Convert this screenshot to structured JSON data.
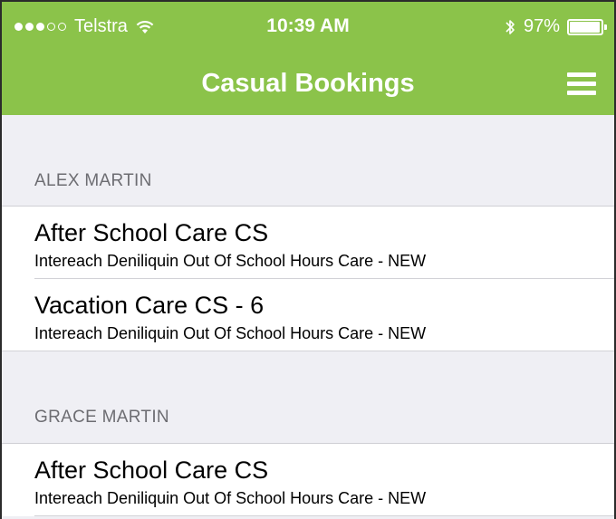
{
  "status_bar": {
    "carrier": "Telstra",
    "time": "10:39 AM",
    "battery": "97%",
    "battery_level": 0.97,
    "signal_bars_filled": 3,
    "signal_bars_total": 5,
    "icons": [
      "signal-dots-icon",
      "wifi-icon",
      "bluetooth-icon",
      "battery-icon"
    ]
  },
  "nav": {
    "title": "Casual Bookings",
    "menu_icon": "hamburger-menu-icon",
    "color": "#8bc34a"
  },
  "sections": [
    {
      "header": "ALEX MARTIN",
      "items": [
        {
          "title": "After School Care CS",
          "subtitle": "Intereach Deniliquin Out Of School Hours Care - NEW"
        },
        {
          "title": "Vacation Care CS - 6",
          "subtitle": "Intereach Deniliquin Out Of School Hours Care - NEW"
        }
      ]
    },
    {
      "header": "GRACE MARTIN",
      "items": [
        {
          "title": "After School Care CS",
          "subtitle": "Intereach Deniliquin Out Of School Hours Care - NEW"
        }
      ]
    }
  ]
}
